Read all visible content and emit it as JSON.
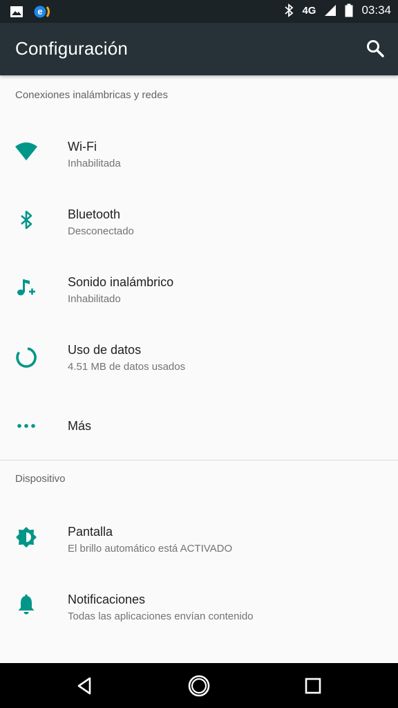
{
  "status_bar": {
    "time": "03:34",
    "network": "4G",
    "icons": [
      "image-icon",
      "app-logo-icon",
      "bluetooth-icon",
      "signal-icon",
      "battery-icon"
    ]
  },
  "app_bar": {
    "title": "Configuración",
    "search_icon": "search-icon"
  },
  "sections": {
    "wireless": {
      "header": "Conexiones inalámbricas y redes",
      "items": [
        {
          "title": "Wi-Fi",
          "subtitle": "Inhabilitada",
          "icon": "wifi-icon"
        },
        {
          "title": "Bluetooth",
          "subtitle": "Desconectado",
          "icon": "bluetooth-icon"
        },
        {
          "title": "Sonido inalámbrico",
          "subtitle": "Inhabilitado",
          "icon": "music-note-plus-icon"
        },
        {
          "title": "Uso de datos",
          "subtitle": "4.51 MB de datos usados",
          "icon": "data-usage-icon"
        },
        {
          "title": "Más",
          "icon": "more-horizontal-icon"
        }
      ]
    },
    "device": {
      "header": "Dispositivo",
      "items": [
        {
          "title": "Pantalla",
          "subtitle": "El brillo automático está ACTIVADO",
          "icon": "brightness-icon"
        },
        {
          "title": "Notificaciones",
          "subtitle": "Todas las aplicaciones envían contenido",
          "icon": "bell-icon"
        }
      ]
    }
  },
  "nav_bar": {
    "icons": [
      "back-icon",
      "home-icon",
      "recents-icon"
    ]
  },
  "colors": {
    "accent": "#009688",
    "app_bar": "#263238",
    "status_bar": "#1b2327",
    "background": "#fafafa"
  }
}
